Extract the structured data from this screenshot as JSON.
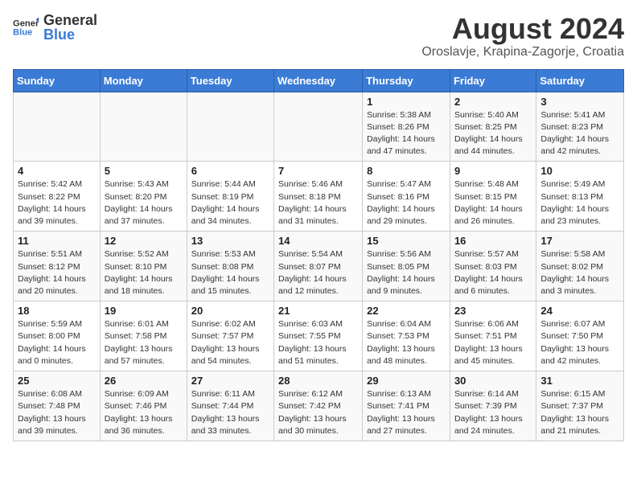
{
  "header": {
    "logo_general": "General",
    "logo_blue": "Blue",
    "month": "August 2024",
    "location": "Oroslavje, Krapina-Zagorje, Croatia"
  },
  "days_of_week": [
    "Sunday",
    "Monday",
    "Tuesday",
    "Wednesday",
    "Thursday",
    "Friday",
    "Saturday"
  ],
  "weeks": [
    [
      {
        "day": "",
        "info": ""
      },
      {
        "day": "",
        "info": ""
      },
      {
        "day": "",
        "info": ""
      },
      {
        "day": "",
        "info": ""
      },
      {
        "day": "1",
        "info": "Sunrise: 5:38 AM\nSunset: 8:26 PM\nDaylight: 14 hours and 47 minutes."
      },
      {
        "day": "2",
        "info": "Sunrise: 5:40 AM\nSunset: 8:25 PM\nDaylight: 14 hours and 44 minutes."
      },
      {
        "day": "3",
        "info": "Sunrise: 5:41 AM\nSunset: 8:23 PM\nDaylight: 14 hours and 42 minutes."
      }
    ],
    [
      {
        "day": "4",
        "info": "Sunrise: 5:42 AM\nSunset: 8:22 PM\nDaylight: 14 hours and 39 minutes."
      },
      {
        "day": "5",
        "info": "Sunrise: 5:43 AM\nSunset: 8:20 PM\nDaylight: 14 hours and 37 minutes."
      },
      {
        "day": "6",
        "info": "Sunrise: 5:44 AM\nSunset: 8:19 PM\nDaylight: 14 hours and 34 minutes."
      },
      {
        "day": "7",
        "info": "Sunrise: 5:46 AM\nSunset: 8:18 PM\nDaylight: 14 hours and 31 minutes."
      },
      {
        "day": "8",
        "info": "Sunrise: 5:47 AM\nSunset: 8:16 PM\nDaylight: 14 hours and 29 minutes."
      },
      {
        "day": "9",
        "info": "Sunrise: 5:48 AM\nSunset: 8:15 PM\nDaylight: 14 hours and 26 minutes."
      },
      {
        "day": "10",
        "info": "Sunrise: 5:49 AM\nSunset: 8:13 PM\nDaylight: 14 hours and 23 minutes."
      }
    ],
    [
      {
        "day": "11",
        "info": "Sunrise: 5:51 AM\nSunset: 8:12 PM\nDaylight: 14 hours and 20 minutes."
      },
      {
        "day": "12",
        "info": "Sunrise: 5:52 AM\nSunset: 8:10 PM\nDaylight: 14 hours and 18 minutes."
      },
      {
        "day": "13",
        "info": "Sunrise: 5:53 AM\nSunset: 8:08 PM\nDaylight: 14 hours and 15 minutes."
      },
      {
        "day": "14",
        "info": "Sunrise: 5:54 AM\nSunset: 8:07 PM\nDaylight: 14 hours and 12 minutes."
      },
      {
        "day": "15",
        "info": "Sunrise: 5:56 AM\nSunset: 8:05 PM\nDaylight: 14 hours and 9 minutes."
      },
      {
        "day": "16",
        "info": "Sunrise: 5:57 AM\nSunset: 8:03 PM\nDaylight: 14 hours and 6 minutes."
      },
      {
        "day": "17",
        "info": "Sunrise: 5:58 AM\nSunset: 8:02 PM\nDaylight: 14 hours and 3 minutes."
      }
    ],
    [
      {
        "day": "18",
        "info": "Sunrise: 5:59 AM\nSunset: 8:00 PM\nDaylight: 14 hours and 0 minutes."
      },
      {
        "day": "19",
        "info": "Sunrise: 6:01 AM\nSunset: 7:58 PM\nDaylight: 13 hours and 57 minutes."
      },
      {
        "day": "20",
        "info": "Sunrise: 6:02 AM\nSunset: 7:57 PM\nDaylight: 13 hours and 54 minutes."
      },
      {
        "day": "21",
        "info": "Sunrise: 6:03 AM\nSunset: 7:55 PM\nDaylight: 13 hours and 51 minutes."
      },
      {
        "day": "22",
        "info": "Sunrise: 6:04 AM\nSunset: 7:53 PM\nDaylight: 13 hours and 48 minutes."
      },
      {
        "day": "23",
        "info": "Sunrise: 6:06 AM\nSunset: 7:51 PM\nDaylight: 13 hours and 45 minutes."
      },
      {
        "day": "24",
        "info": "Sunrise: 6:07 AM\nSunset: 7:50 PM\nDaylight: 13 hours and 42 minutes."
      }
    ],
    [
      {
        "day": "25",
        "info": "Sunrise: 6:08 AM\nSunset: 7:48 PM\nDaylight: 13 hours and 39 minutes."
      },
      {
        "day": "26",
        "info": "Sunrise: 6:09 AM\nSunset: 7:46 PM\nDaylight: 13 hours and 36 minutes."
      },
      {
        "day": "27",
        "info": "Sunrise: 6:11 AM\nSunset: 7:44 PM\nDaylight: 13 hours and 33 minutes."
      },
      {
        "day": "28",
        "info": "Sunrise: 6:12 AM\nSunset: 7:42 PM\nDaylight: 13 hours and 30 minutes."
      },
      {
        "day": "29",
        "info": "Sunrise: 6:13 AM\nSunset: 7:41 PM\nDaylight: 13 hours and 27 minutes."
      },
      {
        "day": "30",
        "info": "Sunrise: 6:14 AM\nSunset: 7:39 PM\nDaylight: 13 hours and 24 minutes."
      },
      {
        "day": "31",
        "info": "Sunrise: 6:15 AM\nSunset: 7:37 PM\nDaylight: 13 hours and 21 minutes."
      }
    ]
  ]
}
